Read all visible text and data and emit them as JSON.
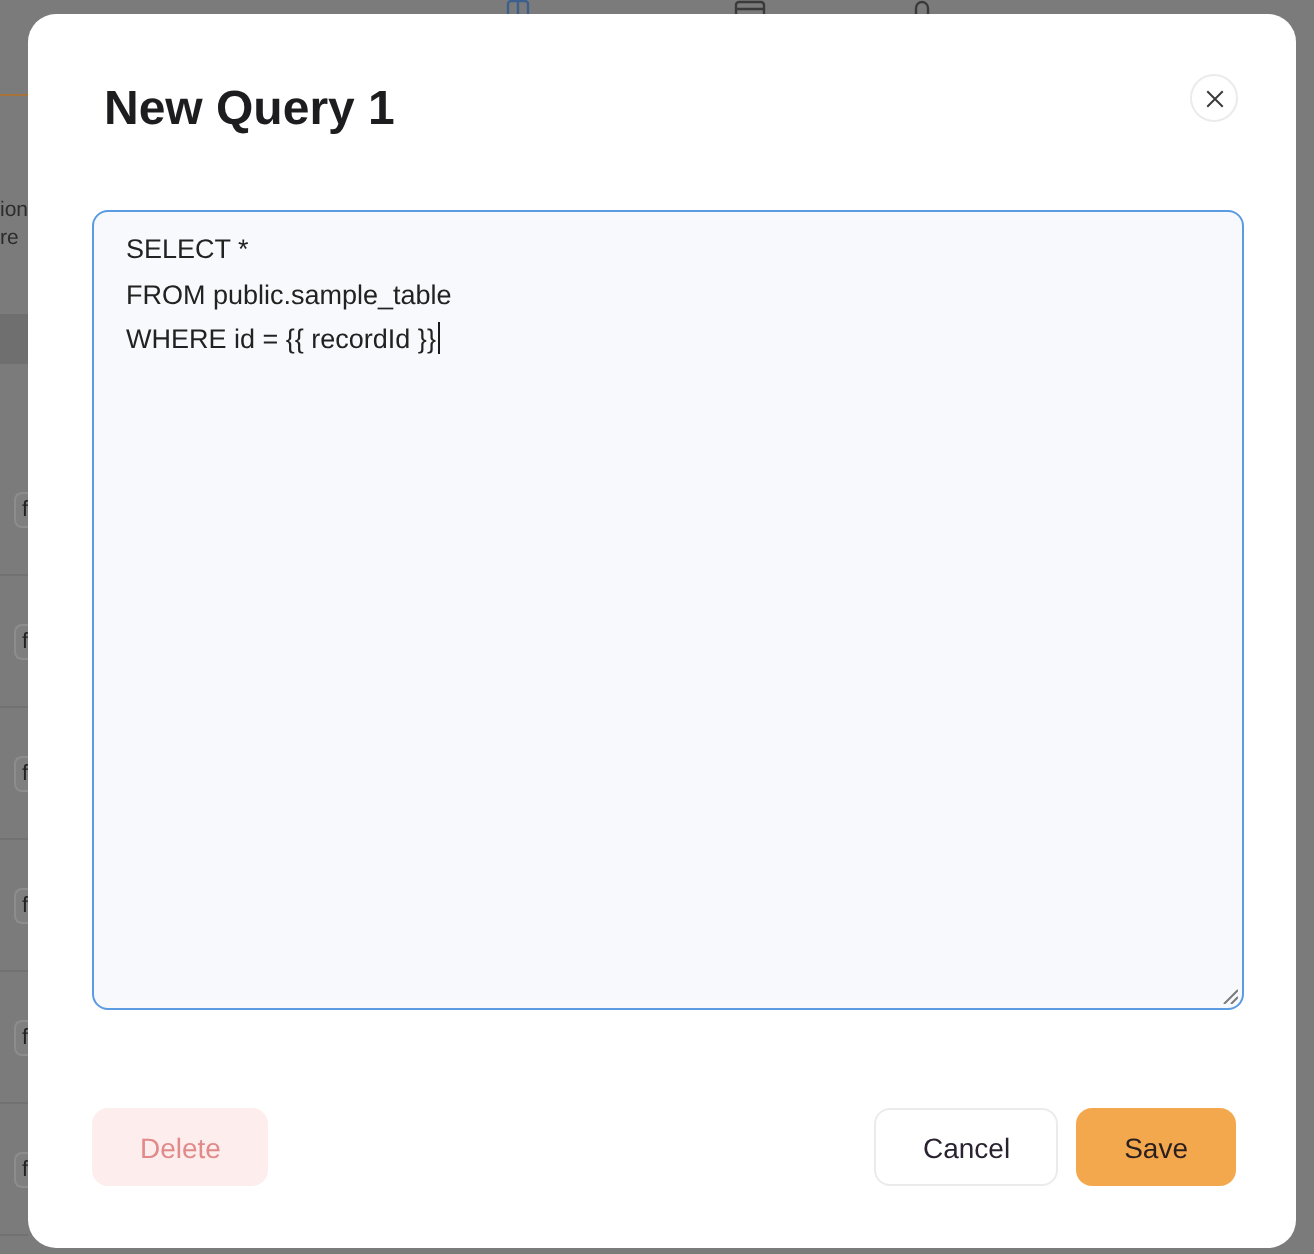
{
  "background": {
    "tabs": [
      {
        "selected": true
      },
      {
        "selected": false
      },
      {
        "selected": false
      }
    ],
    "description_lines": [
      "ion",
      "re"
    ],
    "rows": [
      {
        "badge": "f"
      },
      {
        "badge": "f"
      },
      {
        "badge": "f"
      },
      {
        "badge": "f"
      },
      {
        "badge": "f"
      },
      {
        "badge": "f"
      }
    ]
  },
  "dialog": {
    "title": "New Query 1",
    "editor": {
      "value": "SELECT *\nFROM public.sample_table\nWHERE id = {{ recordId }}",
      "focused": true
    },
    "buttons": [
      {
        "label": "Delete",
        "kind": "danger",
        "disabled": true
      },
      {
        "label": "Cancel",
        "kind": "secondary",
        "disabled": false
      },
      {
        "label": "Save",
        "kind": "primary",
        "disabled": false
      }
    ]
  }
}
